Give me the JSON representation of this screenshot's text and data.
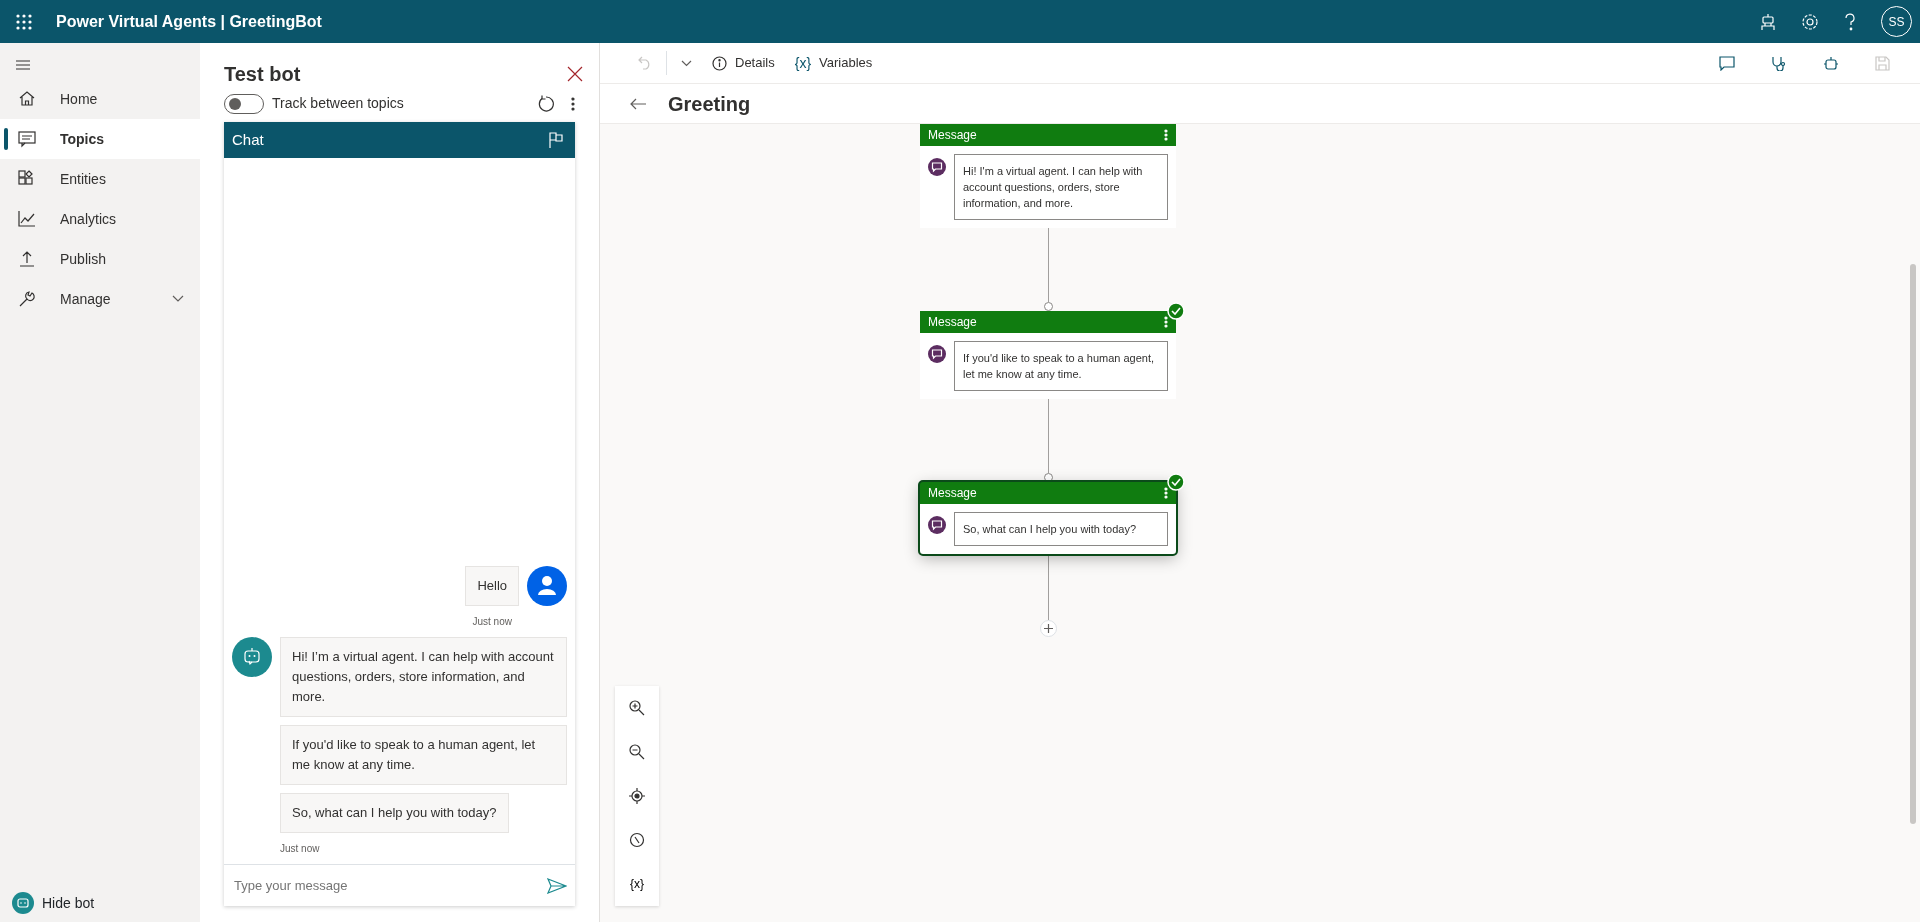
{
  "app": {
    "title": "Power Virtual Agents | GreetingBot",
    "avatar_initials": "SS"
  },
  "sidebar": {
    "items": [
      {
        "label": "Home",
        "kind": "home",
        "selected": false,
        "has_submenu": false
      },
      {
        "label": "Topics",
        "kind": "topics",
        "selected": true,
        "has_submenu": false
      },
      {
        "label": "Entities",
        "kind": "entities",
        "selected": false,
        "has_submenu": false
      },
      {
        "label": "Analytics",
        "kind": "analytics",
        "selected": false,
        "has_submenu": false
      },
      {
        "label": "Publish",
        "kind": "publish",
        "selected": false,
        "has_submenu": false
      },
      {
        "label": "Manage",
        "kind": "manage",
        "selected": false,
        "has_submenu": true
      }
    ],
    "hide_bot": {
      "label": "Hide bot"
    }
  },
  "test_bot": {
    "title": "Test bot",
    "track_toggle": {
      "label": "Track between topics",
      "on": false
    },
    "chat": {
      "title": "Chat",
      "messages": [
        {
          "kind": "user",
          "texts": [
            "Hello"
          ],
          "timestamp": "Just now"
        },
        {
          "kind": "bot",
          "texts": [
            "Hi! I’m a virtual agent. I can help with account questions, orders, store information, and more.",
            "If you'd like to speak to a human agent, let me know at any time.",
            "So, what can I help you with today?"
          ],
          "timestamp": "Just now"
        }
      ],
      "input": {
        "placeholder": "Type your message"
      }
    }
  },
  "toolbar": {
    "undo": {
      "disabled": true
    },
    "buttons": [
      {
        "kind": "details",
        "label": "Details"
      },
      {
        "kind": "variables",
        "icon_text": "{x}",
        "label": "Variables"
      }
    ],
    "save": {
      "disabled": true
    }
  },
  "topic": {
    "title": "Greeting",
    "nodes": [
      {
        "title": "Message",
        "text": "Hi! I'm a virtual agent. I can help with account questions, orders, store information, and more.",
        "checked": false,
        "selected": false
      },
      {
        "title": "Message",
        "text": "If you'd like to speak to a human agent, let me know at any time.",
        "checked": true,
        "selected": false
      },
      {
        "title": "Message",
        "text": "So, what can I help you with today?",
        "checked": true,
        "selected": true
      }
    ]
  },
  "zoom_controls": {
    "variables_text": "{x}"
  }
}
